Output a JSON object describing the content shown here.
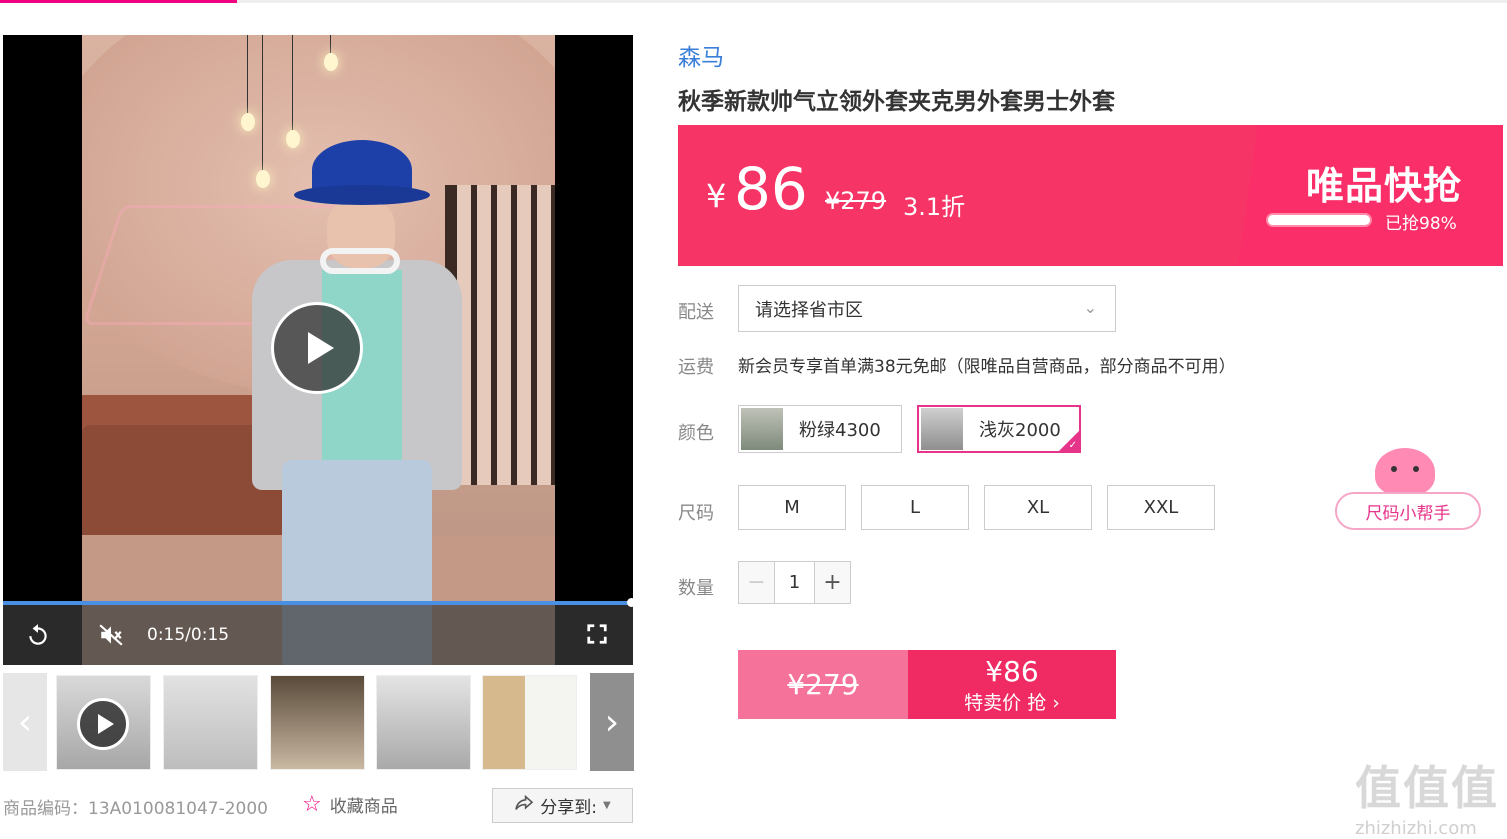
{
  "video": {
    "time": "0:15/0:15",
    "progress_fraction": 1.0
  },
  "thumbnails": [
    {
      "name": "thumb-video",
      "has_play": true,
      "color": "#c9c9c9"
    },
    {
      "name": "thumb-2",
      "has_play": false,
      "color": "#d2d2d2"
    },
    {
      "name": "thumb-3",
      "has_play": false,
      "color": "#a89a86"
    },
    {
      "name": "thumb-4",
      "has_play": false,
      "color": "#cfcfcf"
    },
    {
      "name": "thumb-5",
      "has_play": false,
      "color": "#e8e6de"
    }
  ],
  "product": {
    "code_label": "商品编码：13A010081047-2000",
    "favorite_label": "收藏商品",
    "share_label": "分享到:",
    "brand": "森马",
    "title": "秋季新款帅气立领外套夹克男外套男士外套"
  },
  "price": {
    "yen": "¥",
    "current": "86",
    "original": "¥279",
    "discount": "3.1折",
    "flash_title": "唯品快抢",
    "sold_percent_label": "已抢98%",
    "sold_fraction": 0.98
  },
  "delivery": {
    "label": "配送",
    "placeholder": "请选择省市区"
  },
  "shipping": {
    "label": "运费",
    "text": "新会员专享首单满38元免邮（限唯品自营商品，部分商品不可用）"
  },
  "colors": {
    "label": "颜色",
    "options": [
      {
        "label": "粉绿4300",
        "selected": false
      },
      {
        "label": "浅灰2000",
        "selected": true
      }
    ]
  },
  "sizes": {
    "label": "尺码",
    "options": [
      "M",
      "L",
      "XL",
      "XXL"
    ]
  },
  "size_helper": "尺码小帮手",
  "quantity": {
    "label": "数量",
    "value": "1",
    "minus": "−",
    "plus": "+"
  },
  "buy": {
    "original": "¥279",
    "price": "¥86",
    "action": "特卖价 抢 ›"
  },
  "watermark": {
    "big": "值值值",
    "small": "zhizhizhi.com"
  },
  "colors_theme": {
    "accent_pink": "#f10180",
    "banner": "#f63466",
    "brand_blue": "#3a7fd9"
  }
}
